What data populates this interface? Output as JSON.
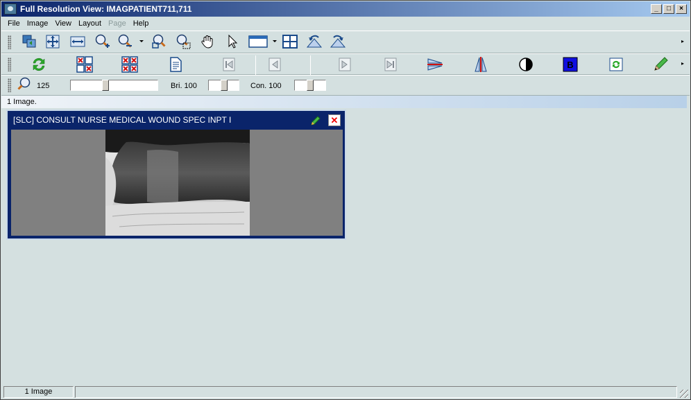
{
  "window": {
    "title": "Full Resolution View: IMAGPATIENT711,711",
    "controls": {
      "minimize": "_",
      "maximize": "□",
      "close": "×"
    }
  },
  "menu": [
    {
      "label": "File",
      "enabled": true
    },
    {
      "label": "Image",
      "enabled": true
    },
    {
      "label": "View",
      "enabled": true
    },
    {
      "label": "Layout",
      "enabled": true
    },
    {
      "label": "Page",
      "enabled": false
    },
    {
      "label": "Help",
      "enabled": true
    }
  ],
  "toolbar1": {
    "icons": [
      "copy-image-icon",
      "fit-to-window-icon",
      "fit-to-width-icon",
      "zoom-in-icon",
      "zoom-out-icon",
      "zoom-dropdown-icon",
      "zoom-region-icon",
      "zoom-rect-icon",
      "pan-hand-icon",
      "pointer-icon",
      "window-layout-icon",
      "layout-dropdown-icon",
      "grid-layout-icon",
      "rotate-left-icon",
      "rotate-right-icon"
    ]
  },
  "toolbar2": {
    "icons": [
      "refresh-icon",
      "clear-selected-icon",
      "clear-all-icon",
      "report-icon",
      "first-page-icon",
      "previous-page-icon",
      "next-page-icon",
      "last-page-icon",
      "flip-vertical-icon",
      "flip-horizontal-icon",
      "invert-icon",
      "brightness-b-icon",
      "reset-icon",
      "annotate-pencil-icon"
    ]
  },
  "toolbar3": {
    "zoom_value": "125",
    "brightness_label": "Bri. 100",
    "contrast_label": "Con. 100"
  },
  "info_strip": {
    "text": "1 Image."
  },
  "image_panel": {
    "title": "[SLC] CONSULT NURSE MEDICAL WOUND SPEC INPT I",
    "image_alt": "wound photograph"
  },
  "statusbar": {
    "pane1": "1 Image"
  },
  "colors": {
    "titlebar_start": "#0a246a",
    "titlebar_end": "#a6caf0",
    "background": "#d4e0e0",
    "panel_title": "#0a246a"
  }
}
